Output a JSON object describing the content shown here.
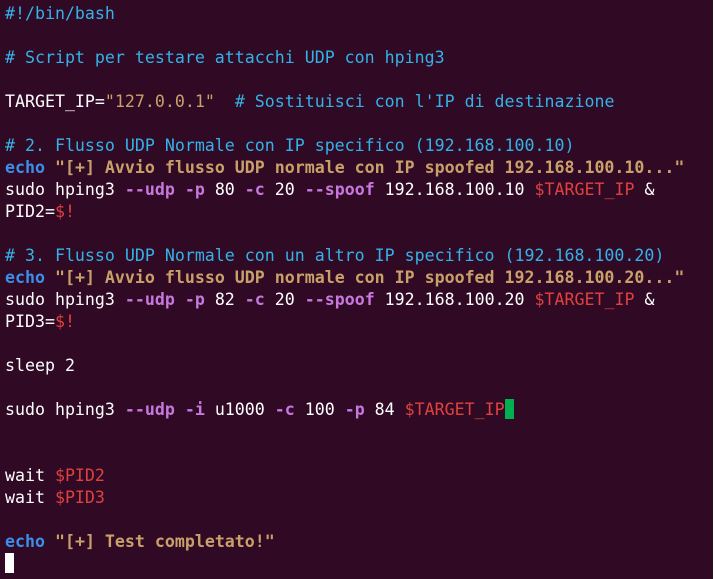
{
  "editor": {
    "colors": {
      "background": "#300a24",
      "plain": "#ffffff",
      "comment": "#34b2e8",
      "keyword": "#3b8eea",
      "string": "#c9a06a",
      "option": "#c678dd",
      "variable": "#e0413f",
      "operator": "#4fc46a",
      "cursor_current": "#00b050"
    },
    "lines": [
      {
        "tokens": [
          {
            "t": "#!/bin/bash",
            "c": "comment"
          }
        ]
      },
      {
        "tokens": []
      },
      {
        "tokens": [
          {
            "t": "# Script per testare attacchi UDP con hping3",
            "c": "comment"
          }
        ]
      },
      {
        "tokens": []
      },
      {
        "tokens": [
          {
            "t": "TARGET_IP",
            "c": "plain"
          },
          {
            "t": "=",
            "c": "plain"
          },
          {
            "t": "\"127.0.0.1\"",
            "c": "string"
          },
          {
            "t": "  ",
            "c": "plain"
          },
          {
            "t": "# Sostituisci con l'IP di destinazione",
            "c": "comment"
          }
        ]
      },
      {
        "tokens": []
      },
      {
        "tokens": [
          {
            "t": "# 2. Flusso UDP Normale con IP specifico (192.168.100.10)",
            "c": "comment"
          }
        ]
      },
      {
        "tokens": [
          {
            "t": "echo",
            "c": "keyword"
          },
          {
            "t": " ",
            "c": "plain"
          },
          {
            "t": "\"[+] Avvio flusso UDP normale con IP spoofed 192.168.100.10...\"",
            "c": "stringb"
          }
        ]
      },
      {
        "tokens": [
          {
            "t": "sudo hping3 ",
            "c": "plain"
          },
          {
            "t": "--udp",
            "c": "option"
          },
          {
            "t": " ",
            "c": "plain"
          },
          {
            "t": "-p",
            "c": "option"
          },
          {
            "t": " 80 ",
            "c": "plain"
          },
          {
            "t": "-c",
            "c": "option"
          },
          {
            "t": " 20 ",
            "c": "plain"
          },
          {
            "t": "--spoof",
            "c": "option"
          },
          {
            "t": " 192.168.100.10 ",
            "c": "plain"
          },
          {
            "t": "$TARGET_IP",
            "c": "var"
          },
          {
            "t": " ",
            "c": "plain"
          },
          {
            "t": "&",
            "c": "operator"
          }
        ]
      },
      {
        "tokens": [
          {
            "t": "PID2",
            "c": "plain"
          },
          {
            "t": "=",
            "c": "plain"
          },
          {
            "t": "$!",
            "c": "var"
          }
        ]
      },
      {
        "tokens": []
      },
      {
        "tokens": [
          {
            "t": "# 3. Flusso UDP Normale con un altro IP specifico (192.168.100.20)",
            "c": "comment"
          }
        ]
      },
      {
        "tokens": [
          {
            "t": "echo",
            "c": "keyword"
          },
          {
            "t": " ",
            "c": "plain"
          },
          {
            "t": "\"[+] Avvio flusso UDP normale con IP spoofed 192.168.100.20...\"",
            "c": "stringb"
          }
        ]
      },
      {
        "tokens": [
          {
            "t": "sudo hping3 ",
            "c": "plain"
          },
          {
            "t": "--udp",
            "c": "option"
          },
          {
            "t": " ",
            "c": "plain"
          },
          {
            "t": "-p",
            "c": "option"
          },
          {
            "t": " 82 ",
            "c": "plain"
          },
          {
            "t": "-c",
            "c": "option"
          },
          {
            "t": " 20 ",
            "c": "plain"
          },
          {
            "t": "--spoof",
            "c": "option"
          },
          {
            "t": " 192.168.100.20 ",
            "c": "plain"
          },
          {
            "t": "$TARGET_IP",
            "c": "var"
          },
          {
            "t": " ",
            "c": "plain"
          },
          {
            "t": "&",
            "c": "operator"
          }
        ]
      },
      {
        "tokens": [
          {
            "t": "PID3",
            "c": "plain"
          },
          {
            "t": "=",
            "c": "plain"
          },
          {
            "t": "$!",
            "c": "var"
          }
        ]
      },
      {
        "tokens": []
      },
      {
        "tokens": [
          {
            "t": "sleep 2",
            "c": "plain"
          }
        ]
      },
      {
        "tokens": []
      },
      {
        "tokens": [
          {
            "t": "sudo hping3 ",
            "c": "plain"
          },
          {
            "t": "--udp",
            "c": "option"
          },
          {
            "t": " ",
            "c": "plain"
          },
          {
            "t": "-i",
            "c": "option"
          },
          {
            "t": " u1000 ",
            "c": "plain"
          },
          {
            "t": "-c",
            "c": "option"
          },
          {
            "t": " 100 ",
            "c": "plain"
          },
          {
            "t": "-p",
            "c": "option"
          },
          {
            "t": " 84 ",
            "c": "plain"
          },
          {
            "t": "$TARGET_I",
            "c": "var"
          },
          {
            "t": "P",
            "c": "var",
            "cursor": "green"
          }
        ]
      },
      {
        "tokens": []
      },
      {
        "tokens": []
      },
      {
        "tokens": [
          {
            "t": "wait ",
            "c": "plain"
          },
          {
            "t": "$PID2",
            "c": "var"
          }
        ]
      },
      {
        "tokens": [
          {
            "t": "wait ",
            "c": "plain"
          },
          {
            "t": "$PID3",
            "c": "var"
          }
        ]
      },
      {
        "tokens": []
      },
      {
        "tokens": [
          {
            "t": "echo",
            "c": "keyword"
          },
          {
            "t": " ",
            "c": "plain"
          },
          {
            "t": "\"[+] Test completato!\"",
            "c": "stringb"
          }
        ]
      },
      {
        "tokens": [],
        "cursor": "white"
      }
    ]
  }
}
